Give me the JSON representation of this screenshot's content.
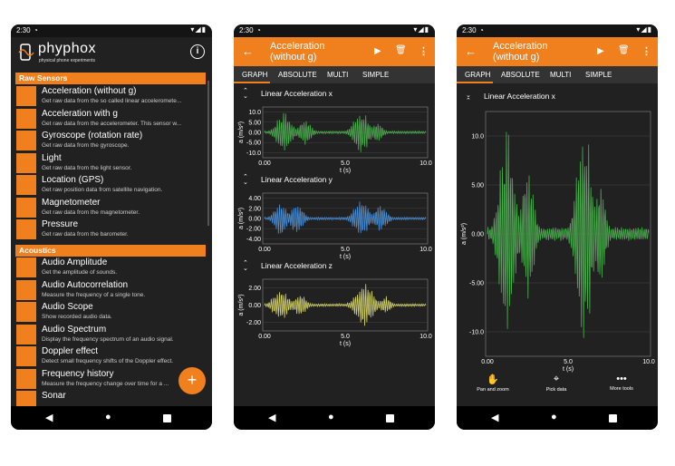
{
  "status": {
    "time": "2:30"
  },
  "menu": {
    "logo": "phyphox",
    "logo_sub": "physical phone experiments",
    "sections": [
      {
        "title": "Raw Sensors",
        "items": [
          {
            "title": "Acceleration (without g)",
            "desc": "Get raw data from the so called linear acceleromete..."
          },
          {
            "title": "Acceleration with g",
            "desc": "Get raw data from the accelerometer. This sensor w..."
          },
          {
            "title": "Gyroscope (rotation rate)",
            "desc": "Get raw data from the gyroscope."
          },
          {
            "title": "Light",
            "desc": "Get raw data from the light sensor."
          },
          {
            "title": "Location (GPS)",
            "desc": "Get raw position data from satellite navigation."
          },
          {
            "title": "Magnetometer",
            "desc": "Get raw data from the magnetometer."
          },
          {
            "title": "Pressure",
            "desc": "Get raw data from the barometer."
          }
        ]
      },
      {
        "title": "Acoustics",
        "items": [
          {
            "title": "Audio Amplitude",
            "desc": "Get the amplitude of sounds."
          },
          {
            "title": "Audio Autocorrelation",
            "desc": "Measure the frequency of a single tone."
          },
          {
            "title": "Audio Scope",
            "desc": "Show recorded audio data."
          },
          {
            "title": "Audio Spectrum",
            "desc": "Display the frequency spectrum of an audio signal."
          },
          {
            "title": "Doppler effect",
            "desc": "Detect small frequency shifts of the Doppler effect."
          },
          {
            "title": "Frequency history",
            "desc": "Measure the frequency change over time for a ..."
          },
          {
            "title": "Sonar",
            "desc": ""
          }
        ]
      }
    ],
    "fab": "+"
  },
  "experiment": {
    "title_line1": "Acceleration",
    "title_line2": "(without g)",
    "tabs": [
      "GRAPH",
      "ABSOLUTE",
      "MULTI",
      "SIMPLE"
    ],
    "graphs": [
      {
        "title": "Linear Acceleration x",
        "ylabel": "a (m/s²)",
        "xlabel": "t (s)",
        "yticks": [
          "10.0",
          "5.00",
          "0.00",
          "-5.00",
          "-10.0"
        ],
        "xticks": [
          "0.00",
          "5.0",
          "10.0"
        ],
        "color": "#4caf50"
      },
      {
        "title": "Linear Acceleration y",
        "ylabel": "a (m/s²)",
        "xlabel": "t (s)",
        "yticks": [
          "4.00",
          "2.00",
          "0.00",
          "-2.00",
          "-4.00"
        ],
        "xticks": [
          "0.00",
          "5.0",
          "10.0"
        ],
        "color": "#4a90d9"
      },
      {
        "title": "Linear Acceleration z",
        "ylabel": "a (m/s²)",
        "xlabel": "t (s)",
        "yticks": [
          "2.00",
          "0.00",
          "-2.00"
        ],
        "xticks": [
          "0.00",
          "5.0",
          "10.0"
        ],
        "color": "#d4d46a"
      }
    ],
    "large_graph": {
      "title": "Linear Acceleration x",
      "ylabel": "a (m/s²)",
      "xlabel": "t (s)",
      "yticks": [
        "10.0",
        "5.00",
        "0.00",
        "-5.00",
        "-10.0"
      ],
      "xticks": [
        "0.00",
        "5.0",
        "10.0"
      ],
      "color": "#4caf50"
    },
    "tools": [
      "Pan and zoom",
      "Pick data",
      "More tools"
    ]
  },
  "chart_data": [
    {
      "type": "line",
      "title": "Linear Acceleration x",
      "xlabel": "t (s)",
      "ylabel": "a (m/s²)",
      "xlim": [
        0,
        10
      ],
      "ylim": [
        -10,
        10
      ],
      "series": [
        {
          "values_description_points": [
            [
              0,
              0
            ],
            [
              1,
              8
            ],
            [
              1.5,
              -8
            ],
            [
              2.5,
              5
            ],
            [
              3,
              0
            ],
            [
              6,
              9
            ],
            [
              6.5,
              -8
            ],
            [
              7.5,
              0
            ],
            [
              10,
              0
            ]
          ]
        }
      ]
    },
    {
      "type": "line",
      "title": "Linear Acceleration y",
      "xlabel": "t (s)",
      "ylabel": "a (m/s²)",
      "xlim": [
        0,
        10
      ],
      "ylim": [
        -4,
        4
      ],
      "series": [
        {
          "values_description_points": [
            [
              0,
              0
            ],
            [
              1,
              3
            ],
            [
              1.5,
              -3
            ],
            [
              3,
              0
            ],
            [
              6,
              3
            ],
            [
              7,
              -3
            ],
            [
              8,
              0
            ],
            [
              10,
              0
            ]
          ]
        }
      ]
    },
    {
      "type": "line",
      "title": "Linear Acceleration z",
      "xlabel": "t (s)",
      "ylabel": "a (m/s²)",
      "xlim": [
        0,
        10
      ],
      "ylim": [
        -3,
        3
      ],
      "series": [
        {
          "values_description_points": [
            [
              0,
              0
            ],
            [
              1,
              2
            ],
            [
              1.5,
              -2
            ],
            [
              3,
              0
            ],
            [
              6,
              2.5
            ],
            [
              7,
              -2
            ],
            [
              8,
              0
            ],
            [
              10,
              0
            ]
          ]
        }
      ]
    }
  ]
}
